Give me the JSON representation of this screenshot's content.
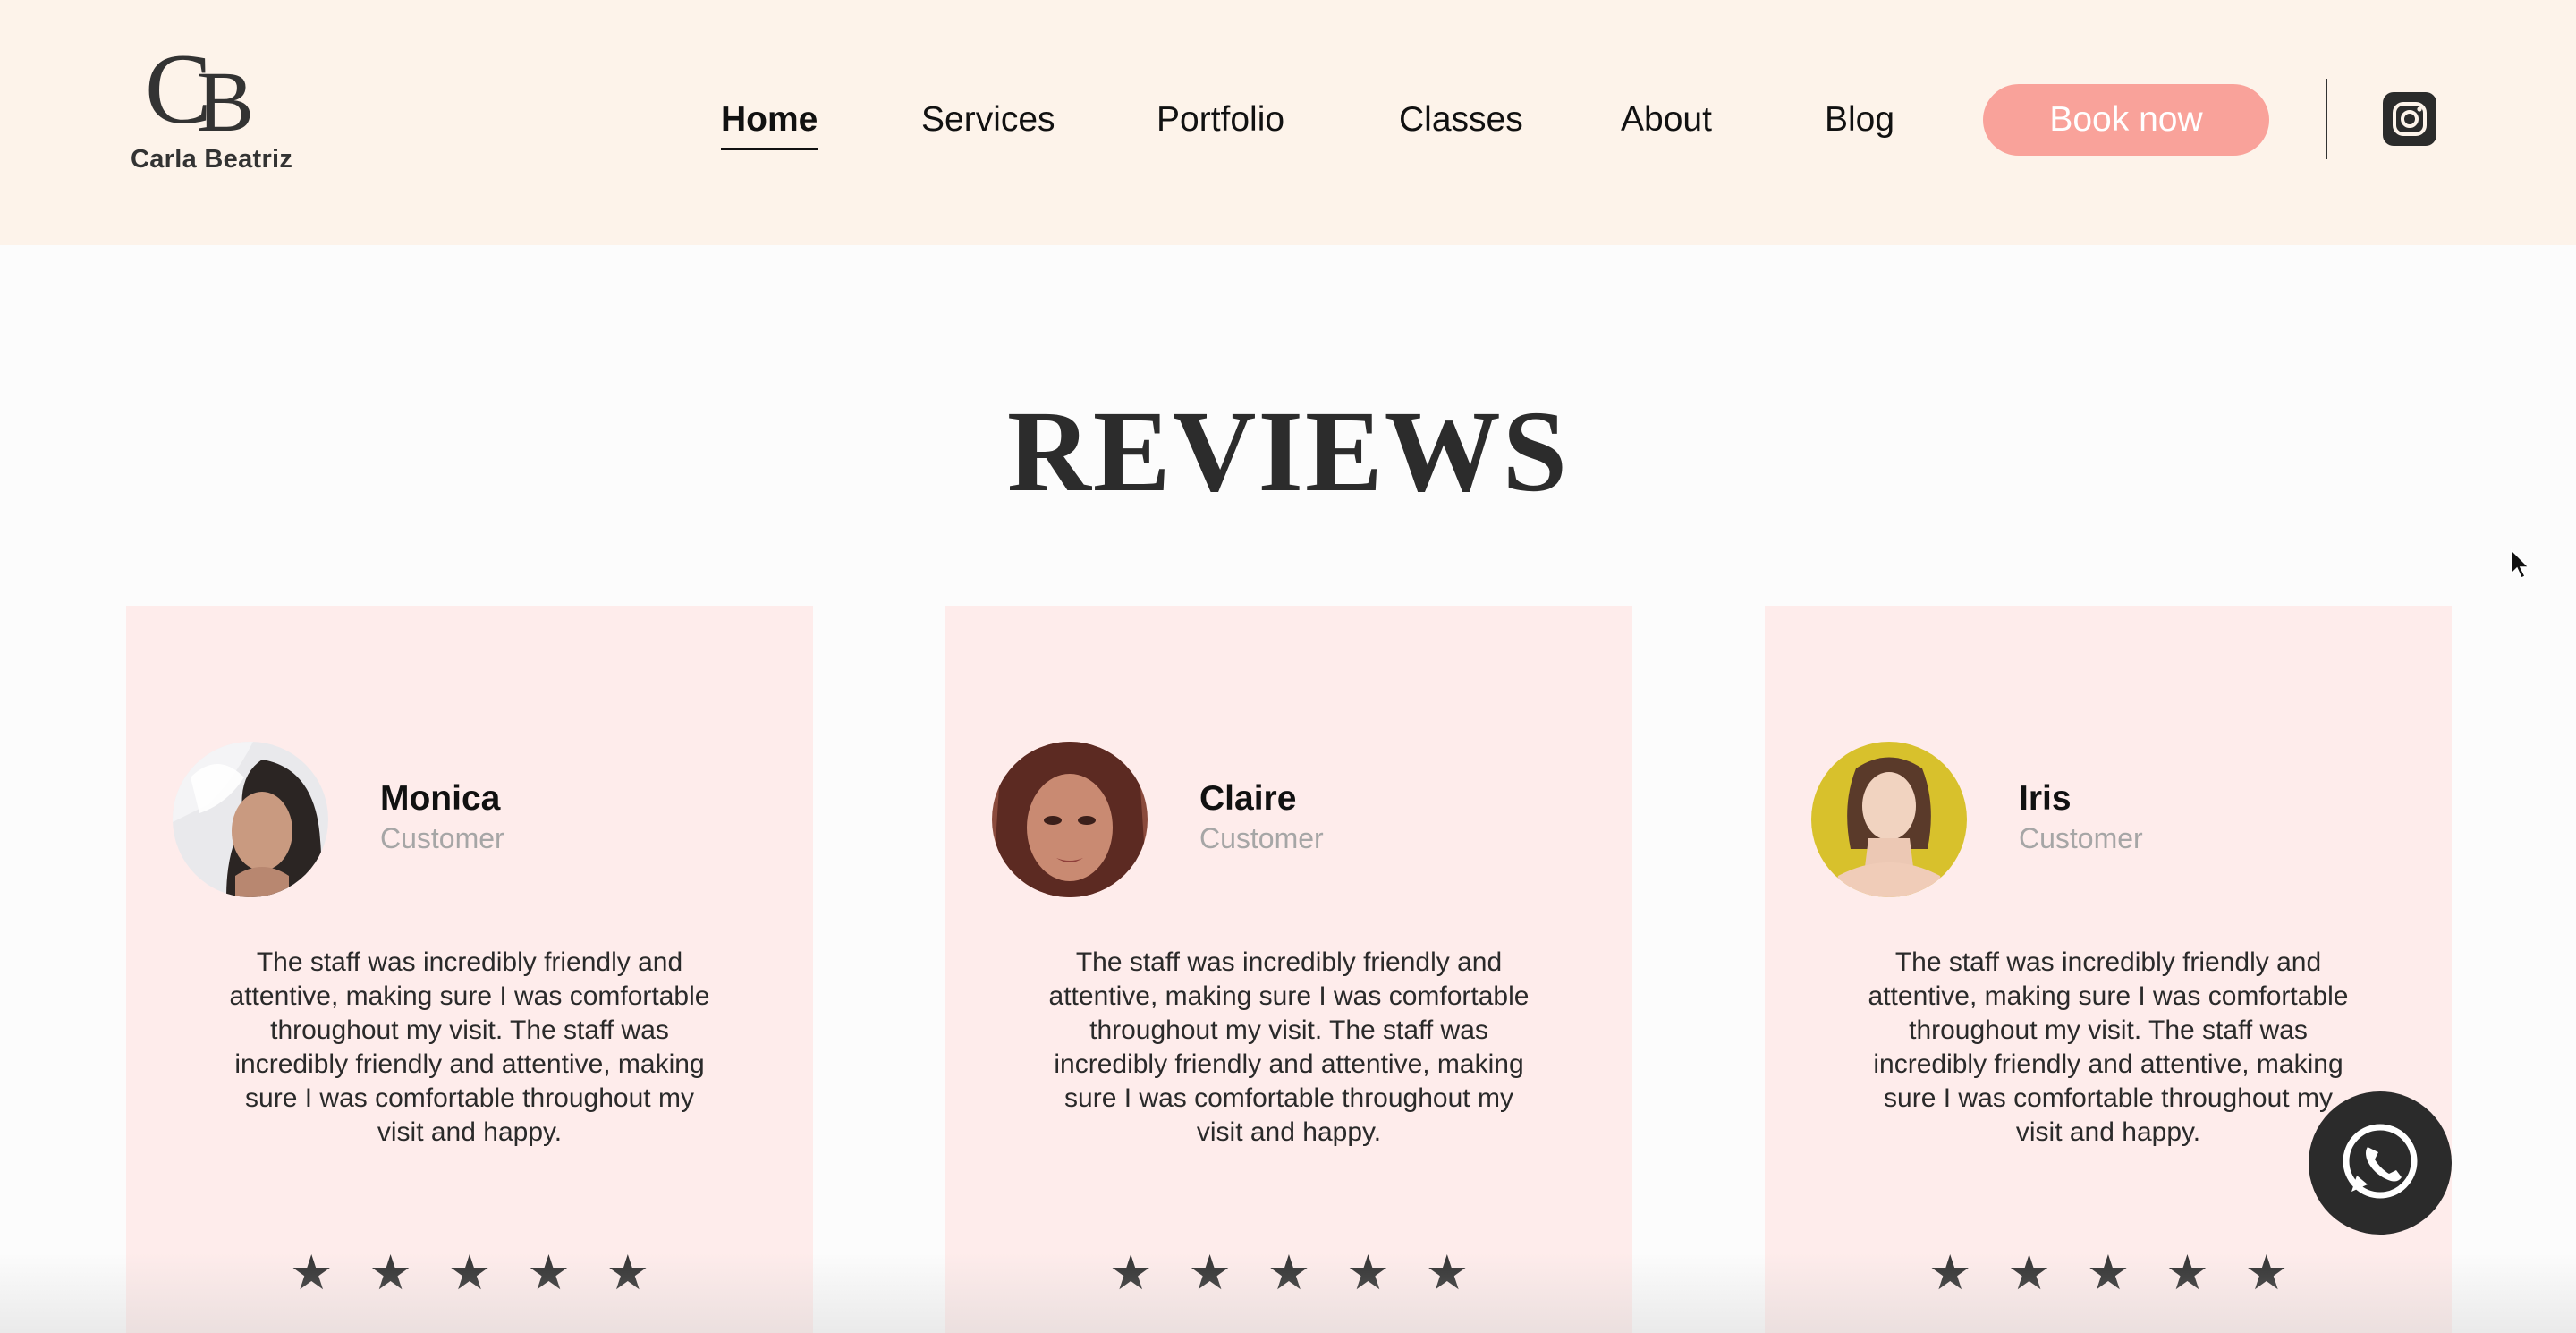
{
  "brand": {
    "monogram_c": "C",
    "monogram_b": "B",
    "name": "Carla Beatriz"
  },
  "nav": {
    "items": [
      {
        "label": "Home",
        "active": true
      },
      {
        "label": "Services",
        "active": false
      },
      {
        "label": "Portfolio",
        "active": false
      },
      {
        "label": "Classes",
        "active": false
      },
      {
        "label": "About",
        "active": false
      },
      {
        "label": "Blog",
        "active": false
      }
    ],
    "cta_label": "Book now"
  },
  "icons": {
    "social": "instagram-icon",
    "chat": "whatsapp-icon",
    "rating": "star-icon"
  },
  "colors": {
    "header_bg": "#fdf3ea",
    "cta_bg": "#f9a29a",
    "card_bg": "#feeceb",
    "muted_text": "#a6a6a6",
    "dark": "#2b2b2b"
  },
  "reviews": {
    "title": "REVIEWS",
    "cards": [
      {
        "name": "Monica",
        "role": "Customer",
        "text": "The staff was incredibly friendly and attentive, making sure I was comfortable throughout my visit. The staff was incredibly friendly and attentive, making sure I was comfortable throughout my visit and happy.",
        "rating": 5
      },
      {
        "name": "Claire",
        "role": "Customer",
        "text": "The staff was incredibly friendly and attentive, making sure I was comfortable throughout my visit. The staff was incredibly friendly and attentive, making sure I was comfortable throughout my visit and happy.",
        "rating": 5
      },
      {
        "name": "Iris",
        "role": "Customer",
        "text": "The staff was incredibly friendly and attentive, making sure I was comfortable throughout my visit. The staff was incredibly friendly and attentive, making sure I was comfortable throughout my visit and happy.",
        "rating": 5
      }
    ]
  }
}
